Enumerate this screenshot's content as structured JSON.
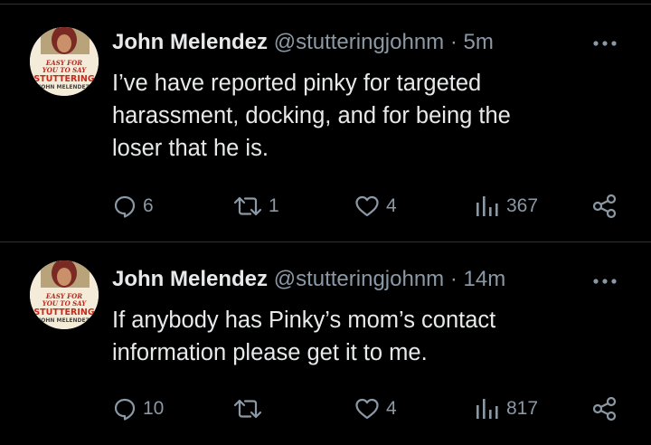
{
  "tweets": [
    {
      "author": {
        "name": "John Melendez",
        "handle": "@stutteringjohnm",
        "avatar_text": [
          "EASY FOR",
          "YOU TO SAY",
          "STUTTERING",
          "JOHN MELENDEZ"
        ]
      },
      "separator": "·",
      "time": "5m",
      "text": "I’ve have reported pinky for targeted\nharassment, docking, and for being the\nloser that he is.",
      "stats": {
        "replies": "6",
        "retweets": "1",
        "likes": "4",
        "views": "367"
      }
    },
    {
      "author": {
        "name": "John Melendez",
        "handle": "@stutteringjohnm",
        "avatar_text": [
          "EASY FOR",
          "YOU TO SAY",
          "STUTTERING",
          "JOHN MELENDEZ"
        ]
      },
      "separator": "·",
      "time": "14m",
      "text": "If anybody has Pinky’s mom’s contact\ninformation please get it to me.",
      "stats": {
        "replies": "10",
        "retweets": "",
        "likes": "4",
        "views": "817"
      }
    }
  ],
  "icons": {
    "reply": "reply-icon",
    "retweet": "retweet-icon",
    "like": "heart-icon",
    "views": "views-icon",
    "share": "share-icon",
    "more": "more-icon"
  },
  "colors": {
    "background": "#000000",
    "text": "#e7e9ea",
    "secondary": "#8b98a5",
    "divider": "#2f3336"
  }
}
